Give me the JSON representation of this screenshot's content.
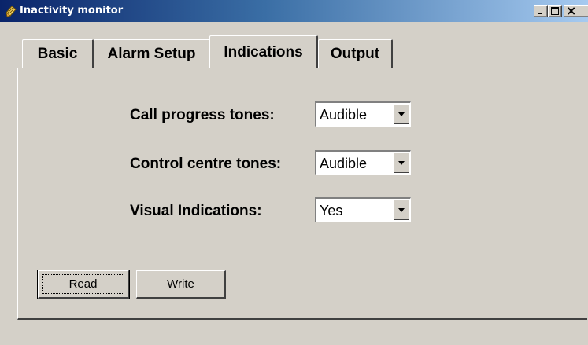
{
  "window": {
    "title": "Inactivity monitor",
    "icon": "notepad-icon",
    "controls": [
      "minimize",
      "maximize",
      "close"
    ],
    "close_glyph": "×"
  },
  "tabs": [
    {
      "label": "Basic",
      "active": false
    },
    {
      "label": "Alarm Setup",
      "active": false
    },
    {
      "label": "Indications",
      "active": true
    },
    {
      "label": "Output",
      "active": false
    }
  ],
  "fields": {
    "call_progress": {
      "label": "Call progress tones:",
      "value": "Audible"
    },
    "control_centre": {
      "label": "Control centre tones:",
      "value": "Audible"
    },
    "visual": {
      "label": "Visual Indications:",
      "value": "Yes"
    }
  },
  "buttons": {
    "read": "Read",
    "write": "Write"
  },
  "colors": {
    "face": "#d4d0c8",
    "title_start": "#0a246a",
    "title_end": "#a6caf0"
  }
}
